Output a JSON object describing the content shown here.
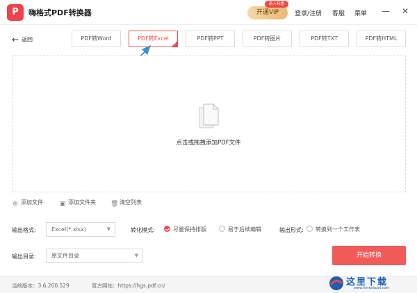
{
  "app": {
    "logo_glyph": "P",
    "title": "嗨格式PDF转换器",
    "vip_label": "开通VIP",
    "vip_badge": "新人特惠",
    "login": "登录/注册",
    "service": "客服",
    "menu": "菜单",
    "minimize": "—",
    "close": "✕"
  },
  "nav": {
    "back": "返回",
    "tabs": [
      {
        "label": "PDF转Word"
      },
      {
        "label": "PDF转Excel"
      },
      {
        "label": "PDF转PPT"
      },
      {
        "label": "PDF转图片"
      },
      {
        "label": "PDF转TXT"
      },
      {
        "label": "PDF转HTML"
      }
    ],
    "active_tab": "PDF转Excel"
  },
  "dropzone": {
    "hint": "点击或拖拽添加PDF文件"
  },
  "actions": {
    "add_file": "添加文件",
    "add_folder": "添加文件夹",
    "clear_list": "清空列表"
  },
  "settings": {
    "output_format_label": "输出格式:",
    "output_format_value": "Excel(*.xlsx)",
    "convert_mode_label": "转化模式:",
    "mode_options": [
      "尽量保持排版",
      "易于后续编辑"
    ],
    "mode_selected": "尽量保持排版",
    "output_form_label": "输出形式:",
    "output_form_option": "转换到一个工作表",
    "output_dir_label": "输出目录:",
    "output_dir_value": "原文件目录",
    "start_button": "开始转换"
  },
  "status": {
    "version": "当前版本：3.6.200.529",
    "website": "官方网站：https://hgs.pdf.cn/"
  },
  "watermark": {
    "text": "这里下载",
    "url": "www.herexiazai.com"
  },
  "colors": {
    "accent": "#f04a4a",
    "start_button": "#f25a5a",
    "arrow": "#3a8fd6"
  }
}
